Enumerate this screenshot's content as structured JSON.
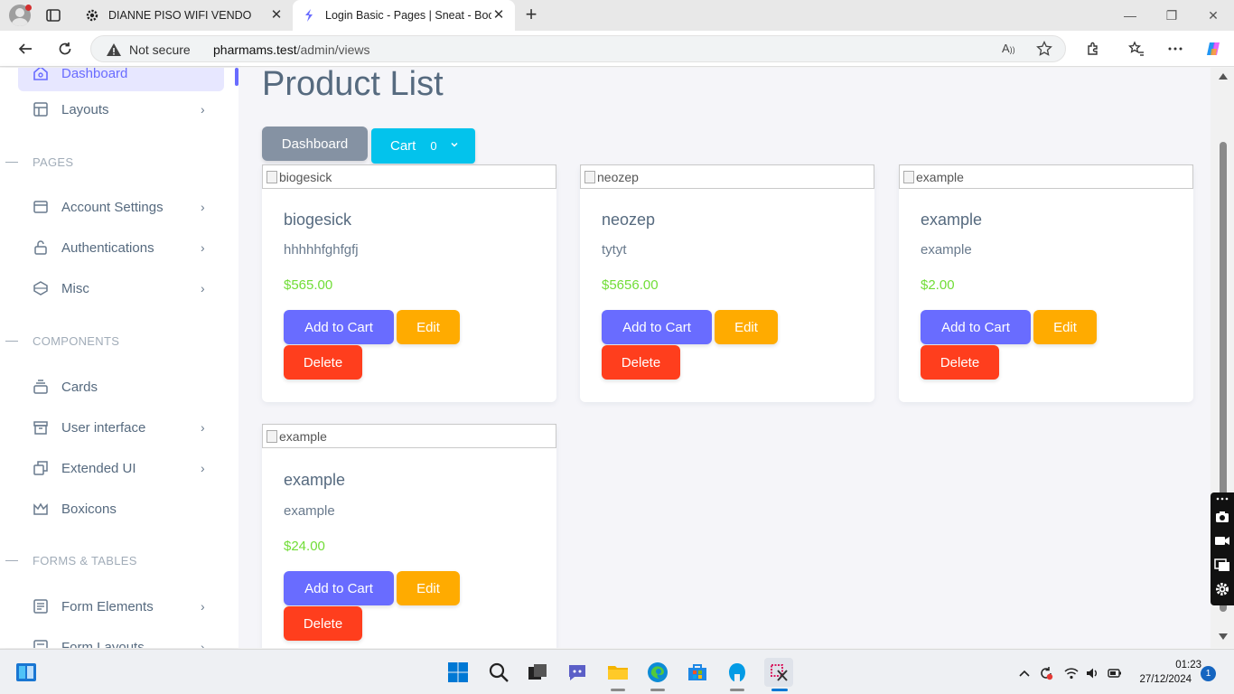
{
  "browser": {
    "tabs": [
      {
        "title": "DIANNE PISO WIFI VENDO",
        "favicon": "gear-icon",
        "active": false
      },
      {
        "title": "Login Basic - Pages | Sneat - Boot",
        "favicon": "sneat-logo-icon",
        "active": true
      }
    ],
    "address": {
      "security_label": "Not secure",
      "host": "pharmams.test",
      "path": "/admin/views"
    }
  },
  "sidebar": {
    "items": [
      {
        "label": "Dashboard",
        "icon": "home-icon",
        "active": true
      },
      {
        "label": "Layouts",
        "icon": "layout-icon",
        "chevron": true
      }
    ],
    "sections": [
      {
        "header": "PAGES",
        "items": [
          {
            "label": "Account Settings",
            "icon": "dock-icon",
            "chevron": true
          },
          {
            "label": "Authentications",
            "icon": "lock-icon",
            "chevron": true
          },
          {
            "label": "Misc",
            "icon": "cube-icon",
            "chevron": true
          }
        ]
      },
      {
        "header": "COMPONENTS",
        "items": [
          {
            "label": "Cards",
            "icon": "collection-icon",
            "chevron": false
          },
          {
            "label": "User interface",
            "icon": "box-icon",
            "chevron": true
          },
          {
            "label": "Extended UI",
            "icon": "copy-icon",
            "chevron": true
          },
          {
            "label": "Boxicons",
            "icon": "crown-icon",
            "chevron": false
          }
        ]
      },
      {
        "header": "FORMS & TABLES",
        "items": [
          {
            "label": "Form Elements",
            "icon": "detail-icon",
            "chevron": true
          },
          {
            "label": "Form Layouts",
            "icon": "detail-icon",
            "chevron": true
          }
        ]
      }
    ]
  },
  "main": {
    "title": "Product List",
    "dashboard_button": "Dashboard",
    "cart_button": "Cart",
    "cart_count": "0",
    "products": [
      {
        "image_alt": "biogesick",
        "name": "biogesick",
        "description": "hhhhhfghfgfj",
        "price": "$565.00"
      },
      {
        "image_alt": "neozep",
        "name": "neozep",
        "description": "tytyt",
        "price": "$5656.00"
      },
      {
        "image_alt": "example",
        "name": "example",
        "description": "example",
        "price": "$2.00"
      },
      {
        "image_alt": "example",
        "name": "example",
        "description": "example",
        "price": "$24.00"
      }
    ],
    "actions": {
      "add": "Add to Cart",
      "edit": "Edit",
      "delete": "Delete"
    }
  },
  "taskbar": {
    "time": "01:23",
    "date": "27/12/2024",
    "notification_count": "1"
  },
  "colors": {
    "primary": "#696cff",
    "info": "#03c3ec",
    "secondary": "#8592a3",
    "warning": "#ffab00",
    "danger": "#ff3e1d",
    "success": "#71dd37"
  }
}
